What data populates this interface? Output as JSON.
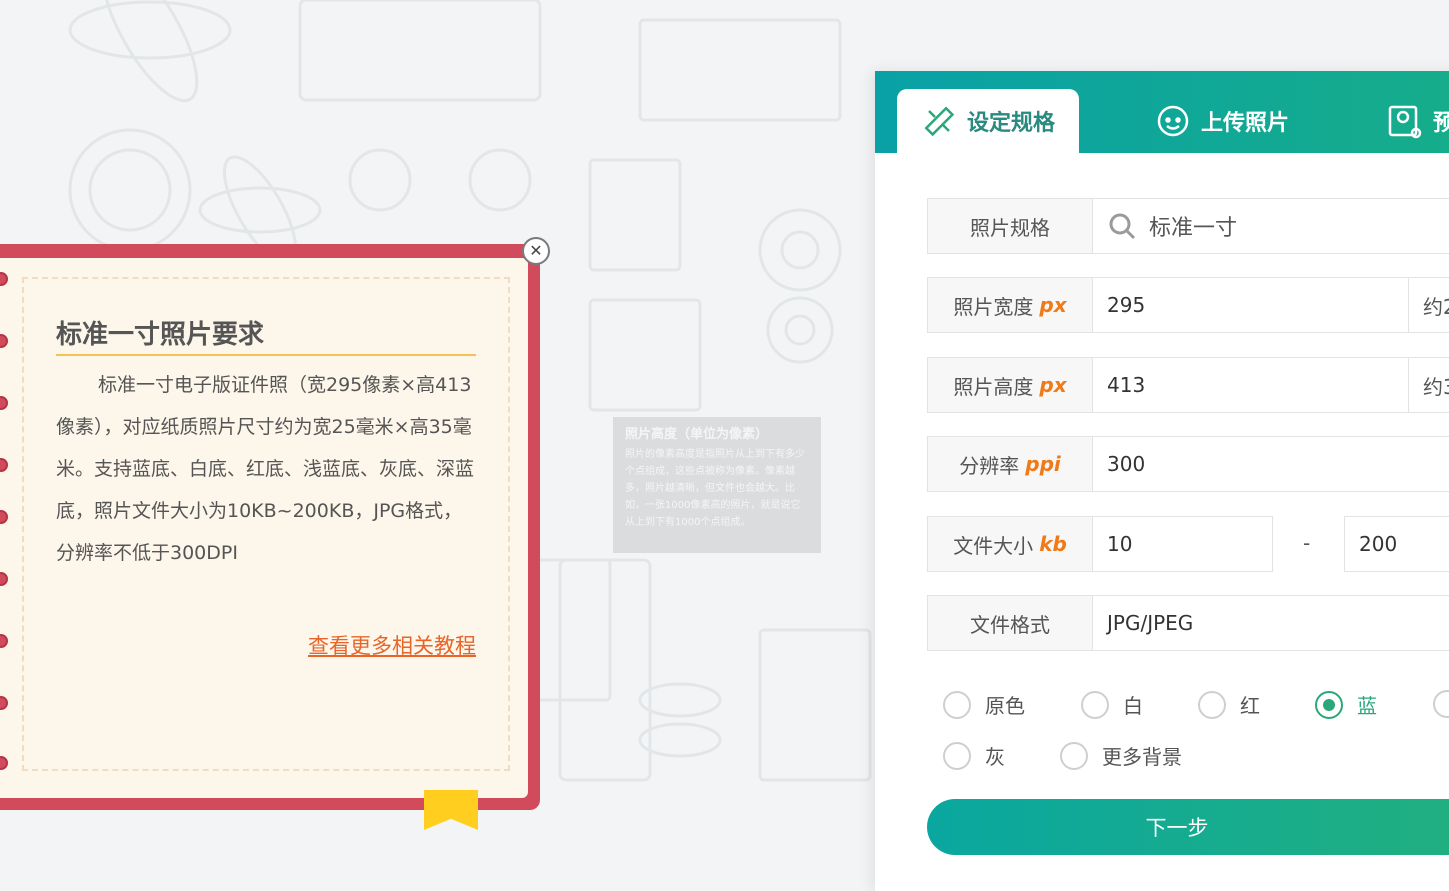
{
  "info_card": {
    "title": "标准一寸照片要求",
    "body": "标准一寸电子版证件照（宽295像素×高413像素），对应纸质照片尺寸约为宽25毫米×高35毫米。支持蓝底、白底、红底、浅蓝底、灰底、深蓝底，照片文件大小为10KB~200KB，JPG格式，分辨率不低于300DPI",
    "link": "查看更多相关教程",
    "close_symbol": "✕"
  },
  "tooltip": {
    "title": "照片高度（单位为像素）",
    "body": "照片的像素高度是指照片从上到下有多少个点组成，这些点被称为像素。像素越多，照片越清晰，但文件也会越大。比如，一张1000像素高的照片，就是说它从上到下有1000个点组成。"
  },
  "tabs": [
    {
      "label": "设定规格",
      "icon": "ruler-pencil-icon"
    },
    {
      "label": "上传照片",
      "icon": "face-icon"
    },
    {
      "label": "预",
      "icon": "portrait-icon"
    }
  ],
  "form": {
    "spec": {
      "label": "照片规格",
      "value": "标准一寸"
    },
    "width": {
      "label": "照片宽度",
      "unit": "px",
      "value": "295",
      "suffix": "约2"
    },
    "height": {
      "label": "照片高度",
      "unit": "px",
      "value": "413",
      "suffix": "约3"
    },
    "resolution": {
      "label": "分辨率",
      "unit": "ppi",
      "value": "300"
    },
    "filesize": {
      "label": "文件大小",
      "unit": "kb",
      "min": "10",
      "separator": "-",
      "max": "200"
    },
    "format": {
      "label": "文件格式",
      "value": "JPG/JPEG"
    }
  },
  "backgrounds": [
    {
      "label": "原色",
      "checked": false
    },
    {
      "label": "白",
      "checked": false
    },
    {
      "label": "红",
      "checked": false
    },
    {
      "label": "蓝",
      "checked": true
    },
    {
      "label": "灰",
      "checked": false
    },
    {
      "label": "更多背景",
      "checked": false
    }
  ],
  "next_button": "下一步",
  "colors": {
    "accent": "#0aa7a0",
    "accent2": "#22b07e",
    "card": "#d24b5d",
    "unit": "#f07a17",
    "link": "#e8652a"
  }
}
